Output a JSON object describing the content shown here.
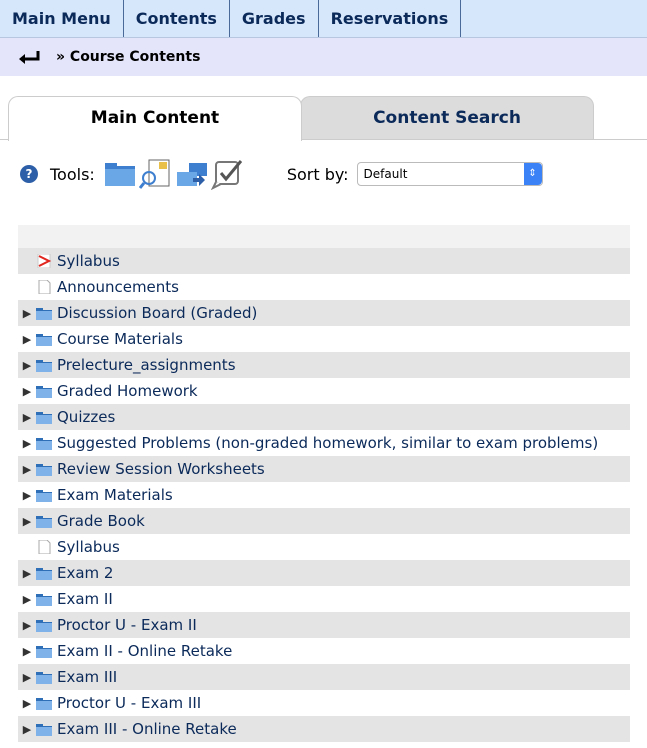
{
  "topnav": {
    "tabs": [
      "Main Menu",
      "Contents",
      "Grades",
      "Reservations"
    ]
  },
  "breadcrumb": {
    "text": "» Course Contents"
  },
  "content_tabs": {
    "main": "Main Content",
    "search": "Content Search"
  },
  "tools": {
    "label": "Tools:",
    "sort_label": "Sort by:",
    "sort_value": "Default",
    "icons": [
      "folder-icon",
      "document-search-icon",
      "folders-icon",
      "checklist-icon"
    ]
  },
  "items": [
    {
      "label": "Syllabus",
      "type": "pdf"
    },
    {
      "label": "Announcements",
      "type": "page"
    },
    {
      "label": "Discussion Board (Graded)",
      "type": "folder"
    },
    {
      "label": "Course Materials",
      "type": "folder"
    },
    {
      "label": "Prelecture_assignments",
      "type": "folder"
    },
    {
      "label": "Graded Homework",
      "type": "folder"
    },
    {
      "label": "Quizzes",
      "type": "folder"
    },
    {
      "label": "Suggested Problems (non-graded homework, similar to exam problems)",
      "type": "folder"
    },
    {
      "label": "Review Session Worksheets",
      "type": "folder"
    },
    {
      "label": "Exam Materials",
      "type": "folder"
    },
    {
      "label": "Grade Book",
      "type": "folder"
    },
    {
      "label": "Syllabus",
      "type": "page"
    },
    {
      "label": "Exam 2",
      "type": "folder"
    },
    {
      "label": "Exam II",
      "type": "folder"
    },
    {
      "label": "Proctor U - Exam II",
      "type": "folder"
    },
    {
      "label": "Exam II - Online Retake",
      "type": "folder"
    },
    {
      "label": "Exam III",
      "type": "folder"
    },
    {
      "label": "Proctor U - Exam III",
      "type": "folder"
    },
    {
      "label": "Exam III - Online Retake",
      "type": "folder"
    }
  ]
}
